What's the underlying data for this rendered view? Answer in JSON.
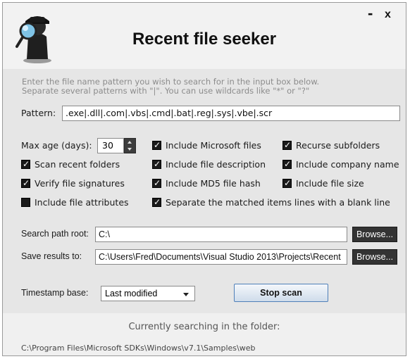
{
  "window": {
    "title": "Recent file seeker",
    "minimize_glyph": "-",
    "close_glyph": "x"
  },
  "instructions": {
    "line1": "Enter the file name pattern you wish to search for in the input box below.",
    "line2": "Separate several patterns with \"|\". You can use wildcards like \"*\" or \"?\""
  },
  "pattern": {
    "label": "Pattern:",
    "value": ".exe|.dll|.com|.vbs|.cmd|.bat|.reg|.sys|.vbe|.scr"
  },
  "max_age": {
    "label": "Max age (days):",
    "value": "30"
  },
  "options": [
    {
      "label": "Include Microsoft files",
      "checked": true
    },
    {
      "label": "Recurse subfolders",
      "checked": true
    },
    {
      "label": "Scan recent folders",
      "checked": true
    },
    {
      "label": "Include file description",
      "checked": true
    },
    {
      "label": "Include company name",
      "checked": true
    },
    {
      "label": "Verify file signatures",
      "checked": true
    },
    {
      "label": "Include MD5 file hash",
      "checked": true
    },
    {
      "label": "Include file size",
      "checked": true
    },
    {
      "label": "Include file attributes",
      "checked": false
    },
    {
      "label": "Separate the matched items lines with a blank line",
      "checked": true
    }
  ],
  "check_glyph": "✓",
  "search_path": {
    "label": "Search path root:",
    "value": "C:\\",
    "browse_label": "Browse..."
  },
  "save_results": {
    "label": "Save results to:",
    "value": "C:\\Users\\Fred\\Documents\\Visual Studio 2013\\Projects\\Recent",
    "browse_label": "Browse..."
  },
  "timestamp": {
    "label": "Timestamp base:",
    "selected": "Last modified"
  },
  "stop_button": {
    "label": "Stop scan"
  },
  "status": {
    "title": "Currently searching in the folder:",
    "path": "C:\\Program Files\\Microsoft SDKs\\Windows\\v7.1\\Samples\\web"
  },
  "colors": {
    "window_bg": "#e6e6e6",
    "header_bg": "#f2f2f2",
    "checkbox": "#1a1a1a",
    "button_dark": "#333333",
    "stop_border": "#4f7fb8"
  },
  "icons": {
    "logo": "detective-magnifier-icon",
    "spin_up": "chevron-up-icon",
    "spin_down": "chevron-down-icon",
    "dropdown": "chevron-down-icon"
  }
}
